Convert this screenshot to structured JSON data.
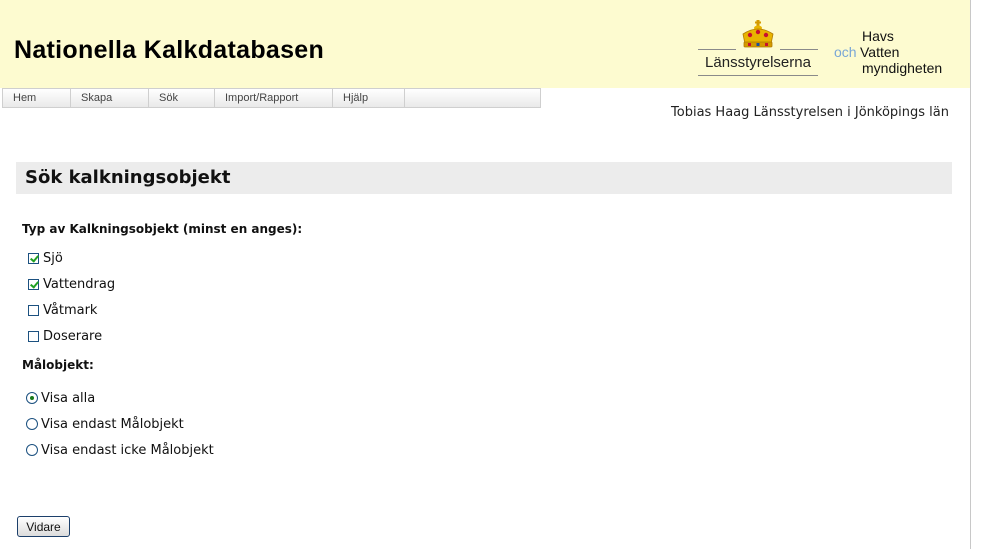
{
  "header": {
    "title": "Nationella Kalkdatabasen",
    "logo_lansstyrelserna": "Länsstyrelserna",
    "logo_hav_och": "och",
    "logo_hav_line1": "Havs",
    "logo_hav_line2": "Vatten",
    "logo_hav_line3": "myndigheten"
  },
  "nav": {
    "items": [
      {
        "label": "Hem"
      },
      {
        "label": "Skapa"
      },
      {
        "label": "Sök"
      },
      {
        "label": "Import/Rapport"
      },
      {
        "label": "Hjälp"
      }
    ]
  },
  "user": "Tobias Haag Länsstyrelsen i Jönköpings län",
  "section": {
    "title": "Sök kalkningsobjekt"
  },
  "typ": {
    "label": "Typ av Kalkningsobjekt (minst en anges):",
    "options": [
      {
        "label": "Sjö",
        "checked": true
      },
      {
        "label": "Vattendrag",
        "checked": true
      },
      {
        "label": "Våtmark",
        "checked": false
      },
      {
        "label": "Doserare",
        "checked": false
      }
    ]
  },
  "malobjekt": {
    "label": "Målobjekt:",
    "options": [
      {
        "label": "Visa alla",
        "selected": true
      },
      {
        "label": "Visa endast Målobjekt",
        "selected": false
      },
      {
        "label": "Visa endast icke Målobjekt",
        "selected": false
      }
    ]
  },
  "buttons": {
    "next_label": "Vidare"
  }
}
